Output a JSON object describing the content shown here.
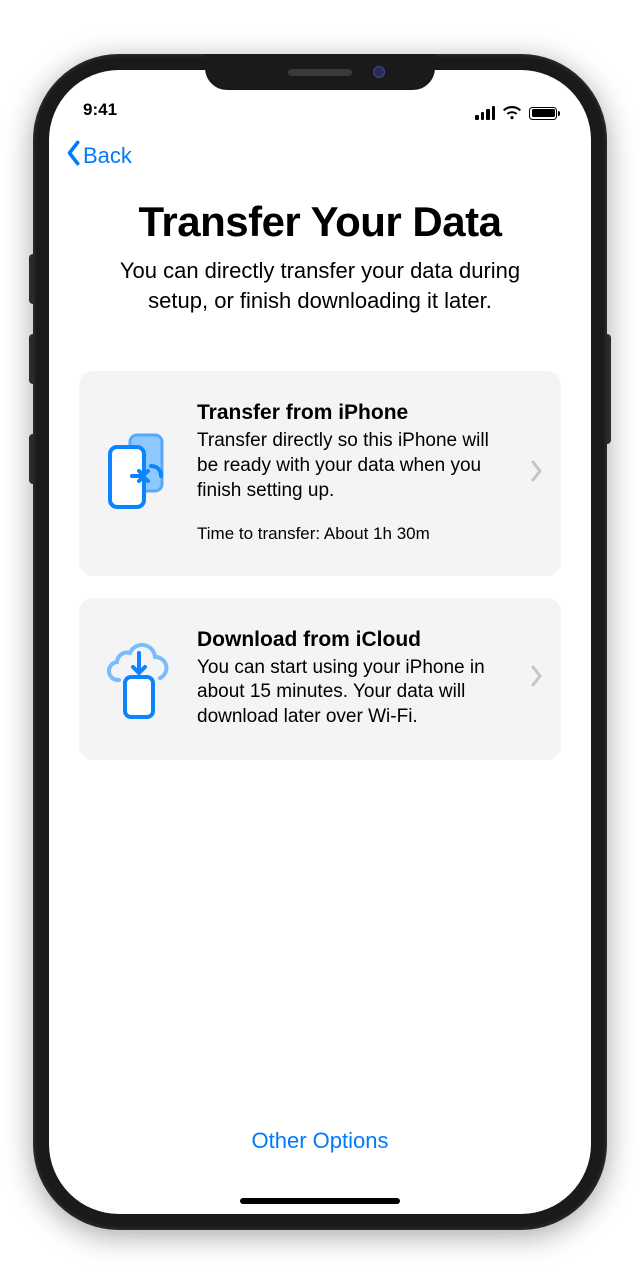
{
  "statusbar": {
    "time": "9:41"
  },
  "nav": {
    "back_label": "Back"
  },
  "header": {
    "title": "Transfer Your Data",
    "subtitle": "You can directly transfer your data during setup, or finish downloading it later."
  },
  "options": {
    "transfer": {
      "title": "Transfer from iPhone",
      "body": "Transfer directly so this iPhone will be ready with your data when you finish setting up.",
      "footnote": "Time to transfer: About 1h 30m"
    },
    "icloud": {
      "title": "Download from iCloud",
      "body": "You can start using your iPhone in about 15 minutes. Your data will download later over Wi-Fi."
    }
  },
  "footer": {
    "other_options": "Other Options"
  },
  "colors": {
    "accent": "#007aff"
  }
}
